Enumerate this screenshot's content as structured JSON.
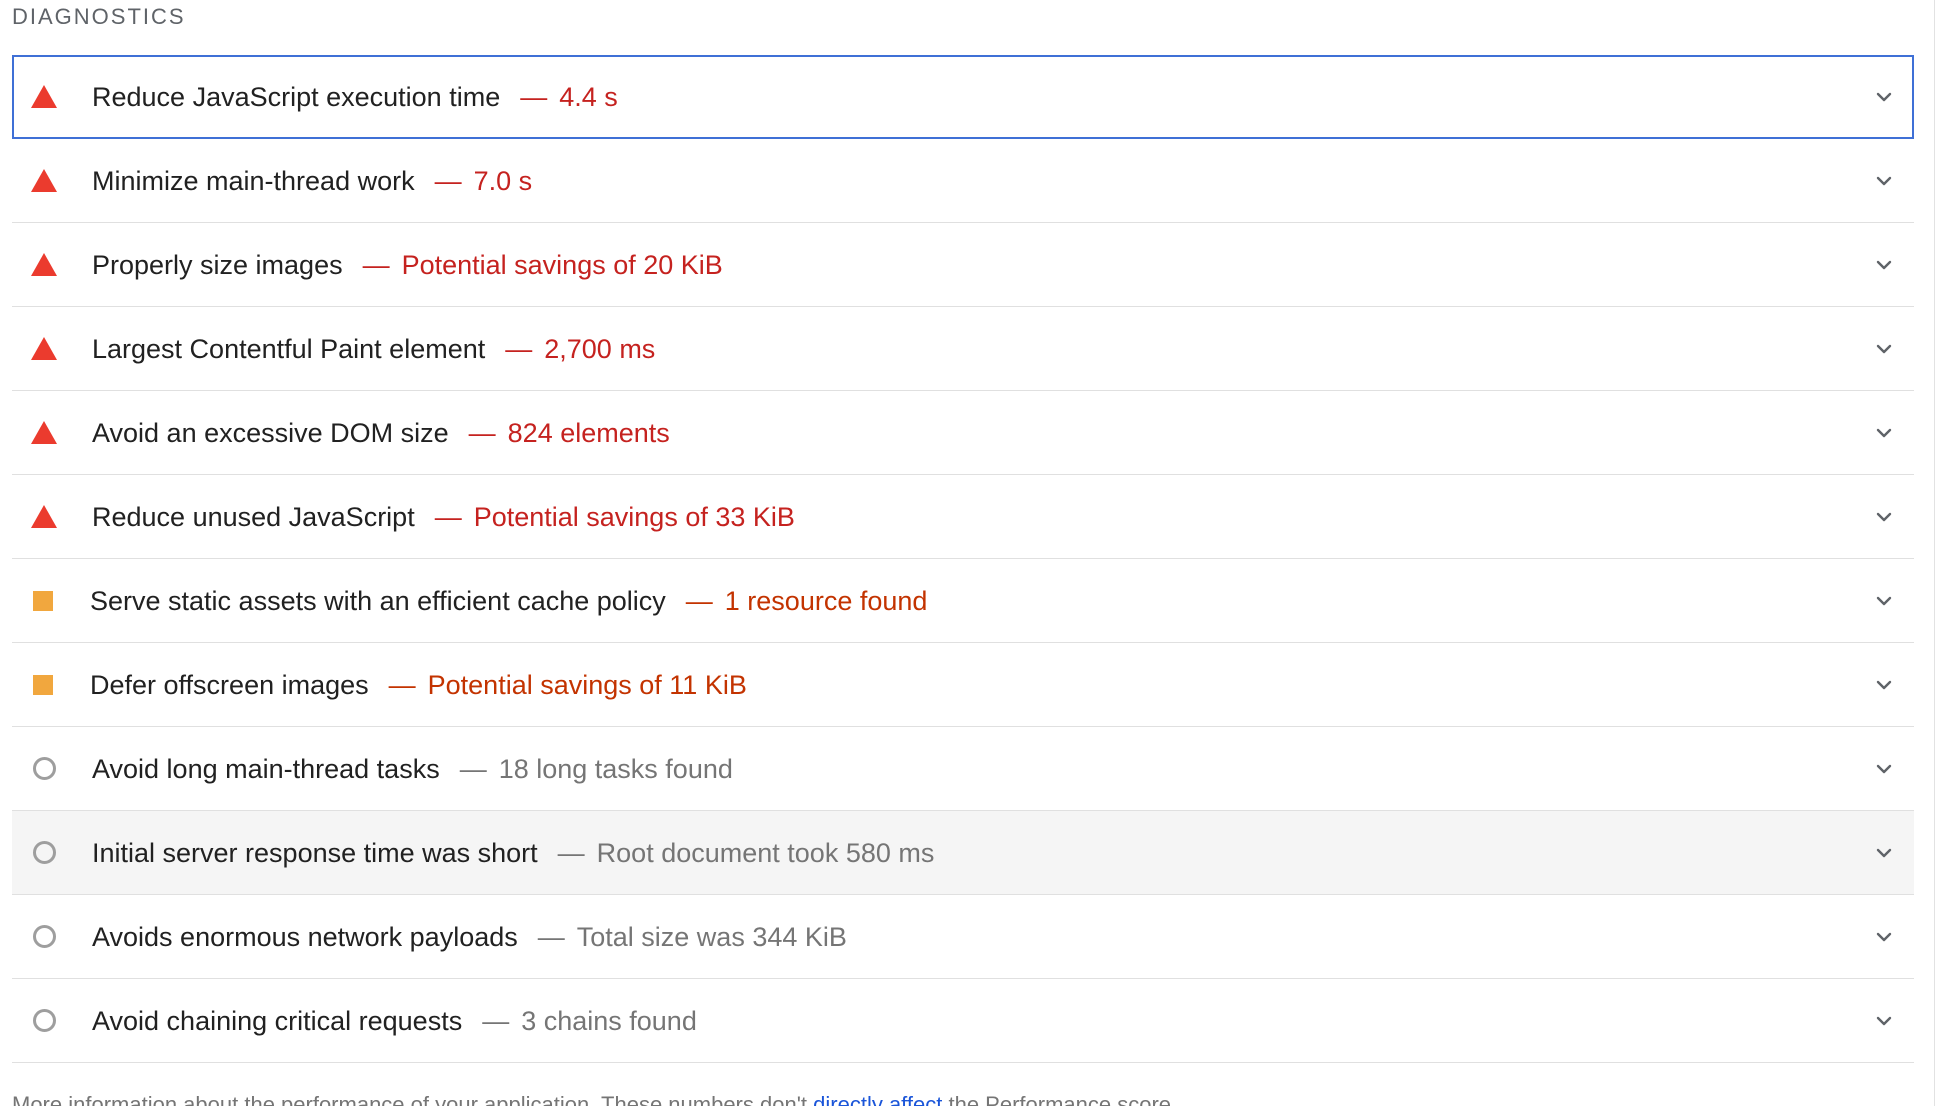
{
  "section": {
    "title": "DIAGNOSTICS"
  },
  "colors": {
    "fail": "#eb3b2e",
    "fail_text": "#c5221f",
    "warn": "#f1a73e",
    "warn_text": "#c33300",
    "info": "#9e9e9e",
    "info_text": "#757575",
    "focus_outline": "#3f70d6",
    "link": "#1a55d9"
  },
  "audits": [
    {
      "status": "fail",
      "icon": "warning-triangle-icon",
      "title": "Reduce JavaScript execution time",
      "separator": "—",
      "display": "4.4 s",
      "focused": true
    },
    {
      "status": "fail",
      "icon": "warning-triangle-icon",
      "title": "Minimize main-thread work",
      "separator": "—",
      "display": "7.0 s"
    },
    {
      "status": "fail",
      "icon": "warning-triangle-icon",
      "title": "Properly size images",
      "separator": "—",
      "display": "Potential savings of 20 KiB"
    },
    {
      "status": "fail",
      "icon": "warning-triangle-icon",
      "title": "Largest Contentful Paint element",
      "separator": "—",
      "display": "2,700 ms"
    },
    {
      "status": "fail",
      "icon": "warning-triangle-icon",
      "title": "Avoid an excessive DOM size",
      "separator": "—",
      "display": "824 elements"
    },
    {
      "status": "fail",
      "icon": "warning-triangle-icon",
      "title": "Reduce unused JavaScript",
      "separator": "—",
      "display": "Potential savings of 33 KiB"
    },
    {
      "status": "warn",
      "icon": "average-square-icon",
      "title": "Serve static assets with an efficient cache policy",
      "separator": "—",
      "display": "1 resource found"
    },
    {
      "status": "warn",
      "icon": "average-square-icon",
      "title": "Defer offscreen images",
      "separator": "—",
      "display": "Potential savings of 11 KiB"
    },
    {
      "status": "info",
      "icon": "info-circle-icon",
      "title": "Avoid long main-thread tasks",
      "separator": "—",
      "display": "18 long tasks found"
    },
    {
      "status": "info",
      "icon": "info-circle-icon",
      "title": "Initial server response time was short",
      "separator": "—",
      "display": "Root document took 580 ms",
      "hovered": true
    },
    {
      "status": "info",
      "icon": "info-circle-icon",
      "title": "Avoids enormous network payloads",
      "separator": "—",
      "display": "Total size was 344 KiB"
    },
    {
      "status": "info",
      "icon": "info-circle-icon",
      "title": "Avoid chaining critical requests",
      "separator": "—",
      "display": "3 chains found"
    }
  ],
  "footer": {
    "text_before": "More information about the performance of your application. These numbers don't ",
    "link_text": "directly affect",
    "text_after": " the Performance score."
  }
}
